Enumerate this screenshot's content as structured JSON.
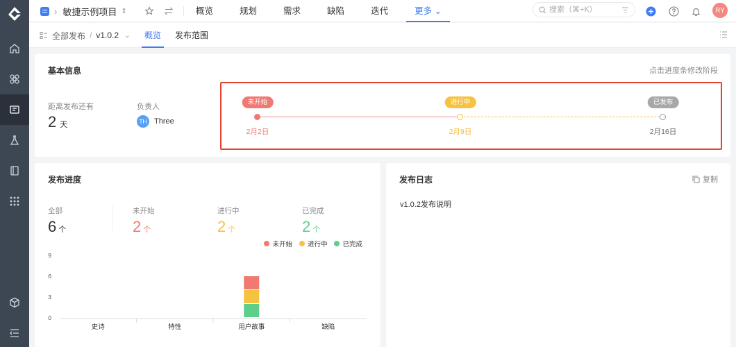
{
  "topbar": {
    "project_name": "敏捷示例项目",
    "nav": [
      {
        "label": "概览",
        "active": false
      },
      {
        "label": "规划",
        "active": false
      },
      {
        "label": "需求",
        "active": false
      },
      {
        "label": "缺陷",
        "active": false
      },
      {
        "label": "迭代",
        "active": false
      },
      {
        "label": "更多",
        "active": true
      }
    ],
    "search_placeholder": "搜索（⌘+K）",
    "avatar": "RY",
    "accent": "#3d7cf5"
  },
  "subbar": {
    "crumb_root": "全部发布",
    "crumb_version": "v1.0.2",
    "tabs": [
      {
        "label": "概览",
        "active": true
      },
      {
        "label": "发布范围",
        "active": false
      }
    ]
  },
  "basic": {
    "title": "基本信息",
    "hint": "点击进度条修改阶段",
    "days_label": "距离发布还有",
    "days_value": "2",
    "days_unit": "天",
    "owner_label": "负责人",
    "owner_initials": "TH",
    "owner_name": "Three",
    "timeline": [
      {
        "label": "未开始",
        "date": "2月2日",
        "color": "#f07a72"
      },
      {
        "label": "进行中",
        "date": "2月9日",
        "color": "#f5c242"
      },
      {
        "label": "已发布",
        "date": "2月16日",
        "color": "#a8a8a8"
      }
    ]
  },
  "progress": {
    "title": "发布进度",
    "stats": [
      {
        "label": "全部",
        "value": "6",
        "unit": "个",
        "color": "#333333"
      },
      {
        "label": "未开始",
        "value": "2",
        "unit": "个",
        "color": "#f07a72"
      },
      {
        "label": "进行中",
        "value": "2",
        "unit": "个",
        "color": "#f5c242"
      },
      {
        "label": "已完成",
        "value": "2",
        "unit": "个",
        "color": "#5fce8a"
      }
    ]
  },
  "chart_data": {
    "type": "bar",
    "stacked": true,
    "categories": [
      "史诗",
      "特性",
      "用户故事",
      "缺陷"
    ],
    "series": [
      {
        "name": "已完成",
        "values": [
          0,
          0,
          2,
          0
        ],
        "color": "#5fce8a"
      },
      {
        "name": "进行中",
        "values": [
          0,
          0,
          2,
          0
        ],
        "color": "#f5c242"
      },
      {
        "name": "未开始",
        "values": [
          0,
          0,
          2,
          0
        ],
        "color": "#f07a72"
      }
    ],
    "legend_order": [
      "未开始",
      "进行中",
      "已完成"
    ],
    "ylim": [
      0,
      9
    ],
    "yticks": [
      "0",
      "3",
      "6",
      "9"
    ],
    "legend_position": "top-right",
    "grid": false
  },
  "log": {
    "title": "发布日志",
    "copy_label": "复制",
    "note": "v1.0.2发布说明"
  }
}
